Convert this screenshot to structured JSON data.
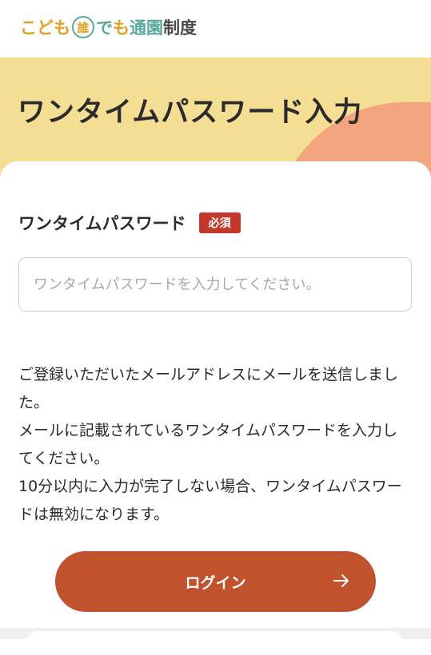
{
  "header": {
    "logo_parts": [
      "こども",
      "誰",
      "で",
      "も",
      "通園",
      "制度"
    ]
  },
  "hero": {
    "title": "ワンタイムパスワード入力"
  },
  "form": {
    "label": "ワンタイムパスワード",
    "required_badge": "必須",
    "input_value": "",
    "input_placeholder": "ワンタイムパスワードを入力してください。"
  },
  "message": {
    "lines": [
      "ご登録いただいたメールアドレスにメールを送信しました。",
      "メールに記載されているワンタイムパスワードを入力してください。",
      "10分以内に入力が完了しない場合、ワンタイムパスワードは無効になります。"
    ]
  },
  "button": {
    "login_label": "ログイン",
    "arrow_icon": "arrow-right-icon"
  },
  "colors": {
    "accent": "#c0532e",
    "hero_bg": "#f4de93",
    "hero_blob": "#f2a57f",
    "badge": "#c0392b"
  }
}
